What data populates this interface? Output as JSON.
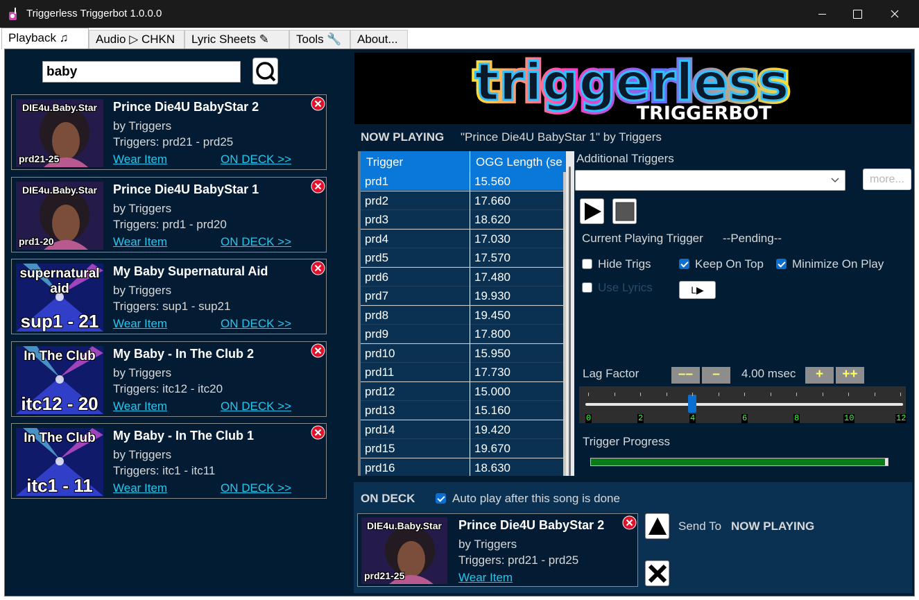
{
  "window": {
    "title": "Triggerless Triggerbot 1.0.0.0",
    "min_icon": "minimize-icon",
    "max_icon": "maximize-icon",
    "close_icon": "close-icon"
  },
  "tabs": [
    {
      "label": "Playback ♫",
      "active": true
    },
    {
      "label": "Audio ▷ CHKN",
      "active": false
    },
    {
      "label": "Lyric Sheets ✎",
      "active": false
    },
    {
      "label": "Tools 🔧",
      "active": false
    },
    {
      "label": "About...",
      "active": false
    }
  ],
  "search": {
    "value": "baby",
    "button_icon": "search-icon"
  },
  "songs": [
    {
      "title": "Prince Die4U BabyStar 2",
      "artist": "by Triggers",
      "triggers": "Triggers: prd21 - prd25",
      "wear": "Wear Item",
      "ondeck": "ON DECK >>",
      "thumb_top": "DIE4u.Baby.Star",
      "thumb_bottom": "prd21-25",
      "thumb_style": "prince"
    },
    {
      "title": "Prince Die4U BabyStar 1",
      "artist": "by Triggers",
      "triggers": "Triggers: prd1 - prd20",
      "wear": "Wear Item",
      "ondeck": "ON DECK >>",
      "thumb_top": "DIE4u.Baby.Star",
      "thumb_bottom": "prd1-20",
      "thumb_style": "prince"
    },
    {
      "title": "My Baby Supernatural Aid",
      "artist": "by Triggers",
      "triggers": "Triggers: sup1 - sup21",
      "wear": "Wear Item",
      "ondeck": "ON DECK >>",
      "thumb_top": "supernatural aid",
      "thumb_bottom": "sup1 - 21",
      "thumb_style": "club"
    },
    {
      "title": "My Baby - In The Club 2",
      "artist": "by Triggers",
      "triggers": "Triggers: itc12 - itc20",
      "wear": "Wear Item",
      "ondeck": "ON DECK >>",
      "thumb_top": "In The Club",
      "thumb_bottom": "itc12 - 20",
      "thumb_style": "club"
    },
    {
      "title": "My Baby - In The Club 1",
      "artist": "by Triggers",
      "triggers": "Triggers: itc1 - itc11",
      "wear": "Wear Item",
      "ondeck": "ON DECK >>",
      "thumb_top": "In The Club",
      "thumb_bottom": "itc1 - 11",
      "thumb_style": "club"
    }
  ],
  "logo": {
    "main": "triggerless",
    "sub": "TRIGGERBOT"
  },
  "now_playing": {
    "label": "NOW PLAYING",
    "song": "\"Prince Die4U BabyStar 1\" by Triggers"
  },
  "trigger_table": {
    "columns": [
      "Trigger",
      "OGG Length (se"
    ],
    "rows": [
      [
        "prd1",
        "15.560"
      ],
      [
        "prd2",
        "17.660"
      ],
      [
        "prd3",
        "18.620"
      ],
      [
        "prd4",
        "17.030"
      ],
      [
        "prd5",
        "17.570"
      ],
      [
        "prd6",
        "17.480"
      ],
      [
        "prd7",
        "19.930"
      ],
      [
        "prd8",
        "19.450"
      ],
      [
        "prd9",
        "17.800"
      ],
      [
        "prd10",
        "15.950"
      ],
      [
        "prd11",
        "17.730"
      ],
      [
        "prd12",
        "15.000"
      ],
      [
        "prd13",
        "15.160"
      ],
      [
        "prd14",
        "19.420"
      ],
      [
        "prd15",
        "19.670"
      ],
      [
        "prd16",
        "18.630"
      ]
    ],
    "selected_index": 0
  },
  "additional_triggers": {
    "label": "Additional Triggers",
    "value": "",
    "more_label": "more..."
  },
  "playback": {
    "play_icon": "play-icon",
    "stop_icon": "stop-icon"
  },
  "current_trigger": {
    "label": "Current Playing Trigger",
    "value": "--Pending--"
  },
  "options": {
    "hide_trigs": {
      "label": "Hide Trigs",
      "checked": false
    },
    "keep_on_top": {
      "label": "Keep On Top",
      "checked": true
    },
    "minimize_on_play": {
      "label": "Minimize On Play",
      "checked": true
    },
    "use_lyrics": {
      "label": "Use Lyrics",
      "checked": false,
      "disabled": true
    },
    "lyrics_button": "L▶"
  },
  "lag": {
    "label": "Lag Factor",
    "minus2": "––",
    "minus1": "–",
    "value": "4.00 msec",
    "plus1": "+",
    "plus2": "++",
    "slider_value": 4,
    "slider_min": 0,
    "slider_max": 12,
    "tick_labels": [
      "0",
      "2",
      "4",
      "6",
      "8",
      "10",
      "12"
    ]
  },
  "progress": {
    "label": "Trigger Progress",
    "value": 0.99
  },
  "on_deck": {
    "label": "ON DECK",
    "auto_play_label": "Auto play after this song is done",
    "auto_play": true,
    "song": {
      "title": "Prince Die4U BabyStar 2",
      "artist": "by Triggers",
      "triggers": "Triggers: prd21 - prd25",
      "wear": "Wear Item",
      "thumb_top": "DIE4u.Baby.Star",
      "thumb_bottom": "prd21-25"
    },
    "send_to_label": "Send To",
    "send_to_target": "NOW PLAYING"
  },
  "colors": {
    "background": "#011c33",
    "panel": "#0a3152",
    "link": "#22c8ee",
    "selection": "#0a78d8",
    "progress": "#0b7a18"
  }
}
